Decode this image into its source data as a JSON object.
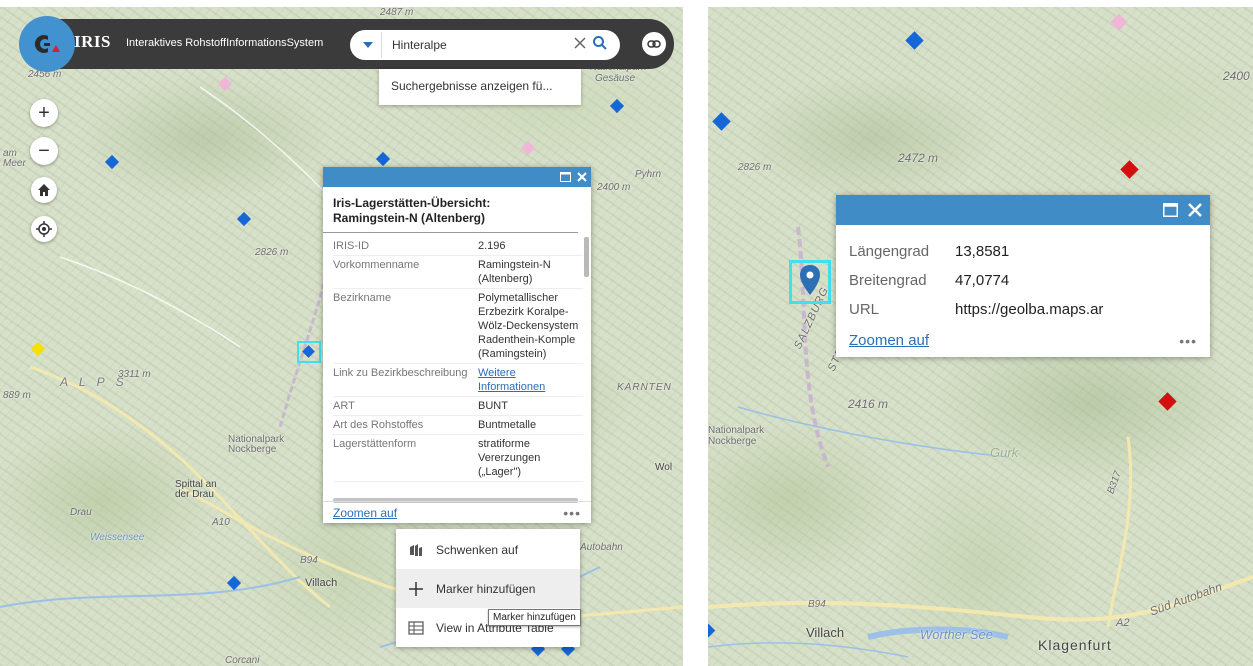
{
  "header": {
    "app_name": "IRIS",
    "app_subtitle": "Interaktives RohstoffInformationsSystem",
    "search_value": "Hinteralpe",
    "search_suggestion": "Suchergebnisse anzeigen fü..."
  },
  "colors": {
    "header_bg": "#3b3b3b",
    "accent": "#3f8cc7",
    "logo_bg": "#4192cf",
    "link": "#2a6ebb",
    "highlight": "#3fe0f0"
  },
  "icons": [
    "iris-logo-icon",
    "chevron-down-icon",
    "clear-icon",
    "search-icon",
    "link-icon",
    "plus-icon",
    "minus-icon",
    "home-icon",
    "locate-icon",
    "maximize-icon",
    "close-icon",
    "ellipsis-icon",
    "pan-icon",
    "add-marker-icon",
    "table-icon",
    "map-pin-icon"
  ],
  "map_left": {
    "labels": {
      "elev_2487": "2487 m",
      "elev_2456": "2456 m",
      "elev_2826": "2826 m",
      "elev_2400": "2400 m",
      "elev_3311": "3311 m",
      "elev_889": "889 m",
      "am_meer": "am Meer",
      "alps": "A L P S",
      "nationalpark_nockberge": "Nationalpark Nockberge",
      "spittal": "Spittal an der Drau",
      "weissensee": "Weissensee",
      "villach": "Villach",
      "wolf": "Wol",
      "drau": "Drau",
      "karnten": "KARNTEN",
      "a10": "A10",
      "autobahn": "Autobahn",
      "b94": "B94",
      "corcani": "Corcani",
      "pyhrn": "Pyhrn",
      "nationalpark": "Nationalpark",
      "gesause": "Gesäuse"
    },
    "zoom_in": "+",
    "zoom_out": "−"
  },
  "popup_left": {
    "title": "Iris-Lagerstätten-Übersicht: Ramingstein-N (Altenberg)",
    "rows": [
      {
        "key": "IRIS-ID",
        "value": "2.196"
      },
      {
        "key": "Vorkommenname",
        "value": "Ramingstein-N (Altenberg)"
      },
      {
        "key": "Bezirkname",
        "value": "Polymetallischer Erzbezirk Koralpe-Wölz-Deckensystem Radenthein-Komple (Ramingstein)"
      },
      {
        "key": "Link zu Bezirkbeschreibung",
        "value": "Weitere Informationen"
      },
      {
        "key": "ART",
        "value": "BUNT"
      },
      {
        "key": "Art des Rohstoffes",
        "value": "Buntmetalle"
      },
      {
        "key": "Lagerstättenform",
        "value": "stratiforme Vererzungen („Lager\")"
      }
    ],
    "zoom_link": "Zoomen auf",
    "more": "•••"
  },
  "action_menu": {
    "items": [
      {
        "label": "Schwenken auf"
      },
      {
        "label": "Marker hinzufügen"
      },
      {
        "label": "View in Attribute Table"
      }
    ],
    "tooltip": "Marker hinzufügen"
  },
  "map_right": {
    "labels": {
      "elev_2826": "2826 m",
      "elev_2472": "2472 m",
      "elev_2400": "2400",
      "elev_2416": "2416 m",
      "nationalpark_nockberge": "Nationalpark Nockberge",
      "villach": "Villach",
      "worther_see": "Worther See",
      "klagenfurt": "Klagenfurt",
      "sud_autobahn": "Süd Autobahn",
      "a2": "A2",
      "b94": "B94",
      "b317": "B317",
      "gurk": "Gurk",
      "salzburg": "SALZBURG",
      "steiermark": "STEI"
    }
  },
  "popup_right": {
    "rows": [
      {
        "key": "Längengrad",
        "value": "13,8581"
      },
      {
        "key": "Breitengrad",
        "value": "47,0774"
      },
      {
        "key": "URL",
        "value": "https://geolba.maps.ar"
      }
    ],
    "zoom_link": "Zoomen auf",
    "more": "•••"
  }
}
